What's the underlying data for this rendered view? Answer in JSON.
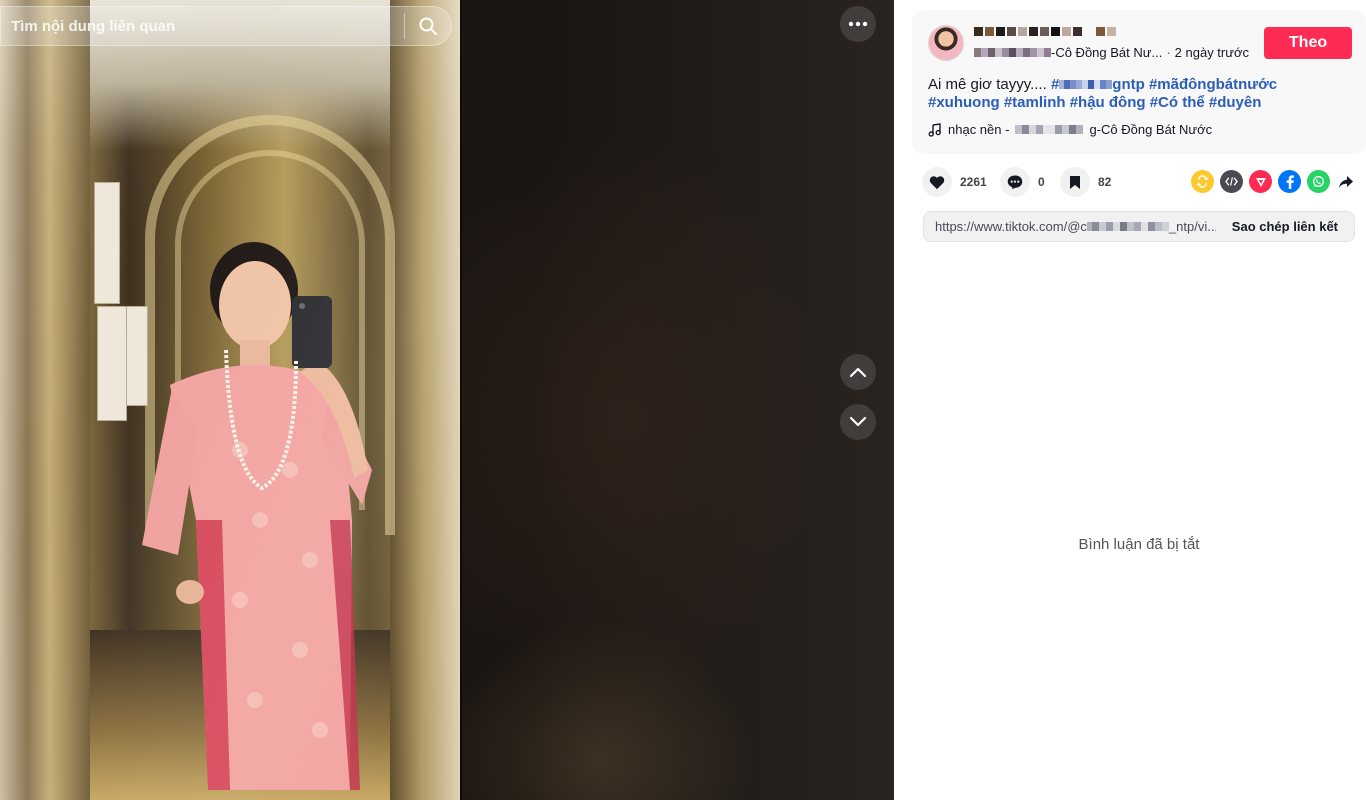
{
  "search": {
    "placeholder": "Tìm nội dung liên quan",
    "icon": "search-icon"
  },
  "stage": {
    "more_icon": "more-horizontal-icon",
    "prev_icon": "chevron-up-icon",
    "next_icon": "chevron-down-icon"
  },
  "author": {
    "channel_suffix": "-Cô Đồng Bát Nư...",
    "time": "2 ngày trước",
    "follow_label": "Theo"
  },
  "caption": {
    "text": "Ai mê giơ tayyy....",
    "tag_1_prefix": "#",
    "tag_1_suffix": "gntp",
    "tags": [
      "#mãđôngbátnước",
      "#xuhuong",
      "#tamlinh",
      "#hậu đông",
      "#Có thể",
      "#duyên"
    ]
  },
  "music": {
    "prefix": "nhạc nền -",
    "suffix": "g-Cô Đồng Bát Nước"
  },
  "stats": {
    "likes": "2261",
    "comments": "0",
    "saves": "82"
  },
  "link": {
    "prefix": "https://www.tiktok.com/@c",
    "suffix": "_ntp/vi...",
    "copy_label": "Sao chép liên kết"
  },
  "comments_off": "Bình luận đã bị tắt",
  "colors": {
    "accent": "#fe2c55",
    "hashtag": "#2b5db9"
  }
}
